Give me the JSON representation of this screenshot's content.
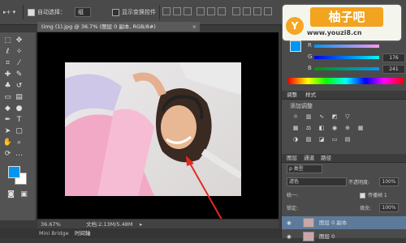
{
  "options_bar": {
    "auto_select_label": "自动选择：",
    "auto_select_value": "组",
    "show_transform_label": "显示变换控件"
  },
  "document_tab": {
    "title": "timg (1).jpg @ 36.7% (图层 0 副本, RGB/8#)",
    "close": "×"
  },
  "status_bar": {
    "zoom": "36.67%",
    "doc_info": "文档:2.13M/5.48M"
  },
  "bottom_tabs": [
    "Mini Bridge",
    "时间轴"
  ],
  "color_panel": {
    "channels": [
      {
        "label": "R",
        "value": ""
      },
      {
        "label": "G",
        "value": "176"
      },
      {
        "label": "B",
        "value": "241"
      }
    ],
    "foreground_color": "#0096f0"
  },
  "adjustments_panel": {
    "tabs": [
      "调整",
      "样式"
    ],
    "hint": "添加调整"
  },
  "layers_panel": {
    "tabs": [
      "图层",
      "通道",
      "路径"
    ],
    "filter_label": "ρ 类型",
    "blend_mode": "滤色",
    "opacity_label": "不透明度:",
    "opacity_value": "100%",
    "unify_label": "统一:",
    "propagate_label": "传播帧 1",
    "lock_label": "锁定:",
    "fill_label": "填充:",
    "fill_value": "100%",
    "layers": [
      {
        "name": "图层 0 副本",
        "selected": true
      },
      {
        "name": "图层 0",
        "selected": false
      }
    ]
  },
  "watermark": {
    "logo_letter": "Y",
    "title": "柚子吧",
    "url": "www.youzi8.cn"
  },
  "icons": {
    "move": "move-icon",
    "marquee": "marquee-icon",
    "lasso": "lasso-icon",
    "crop": "crop-icon",
    "eyedropper": "eyedropper-icon",
    "brush": "brush-icon",
    "stamp": "clone-stamp-icon",
    "eraser": "eraser-icon",
    "gradient": "gradient-icon",
    "pen": "pen-icon",
    "text": "text-icon",
    "hand": "hand-icon",
    "zoom": "zoom-icon"
  }
}
